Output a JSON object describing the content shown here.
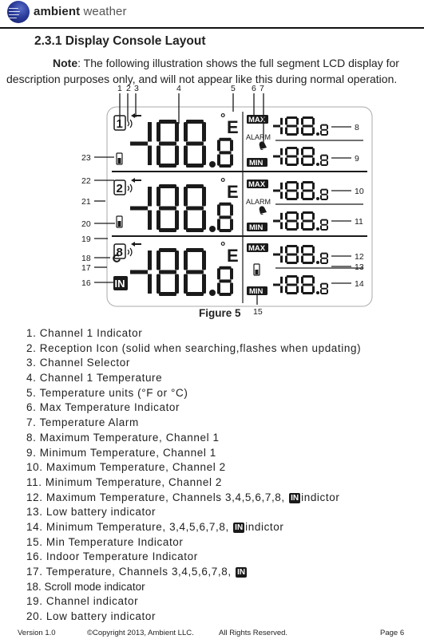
{
  "header": {
    "brand_bold": "ambient",
    "brand_light": " weather"
  },
  "section": {
    "title": "2.3.1 Display Console Layout",
    "note_label": "Note",
    "note_text": ": The following illustration shows the full segment LCD display for description purposes only, and will not appear like this during normal operation."
  },
  "figure": {
    "caption": "Figure 5",
    "lcd": {
      "main_digits": "188.8",
      "side_digits": "188.8",
      "unit": "°F",
      "max_label": "MAX",
      "min_label": "MIN",
      "alarm_label": "ALARM",
      "in_label": "IN",
      "channel_rows": [
        "1",
        "2",
        "8"
      ]
    },
    "callouts": [
      "1",
      "2",
      "3",
      "4",
      "5",
      "6",
      "7",
      "8",
      "9",
      "10",
      "11",
      "12",
      "13",
      "14",
      "15",
      "16",
      "17",
      "18",
      "19",
      "20",
      "21",
      "22",
      "23"
    ]
  },
  "legend": [
    {
      "text": "1. Channel 1 Indicator"
    },
    {
      "text": "2. Reception Icon (solid when searching,flashes when updating)"
    },
    {
      "text": "3. Channel Selector"
    },
    {
      "text": "4. Channel 1 Temperature"
    },
    {
      "text": "5. Temperature units (°F or °C)"
    },
    {
      "text": "6. Max Temperature Indicator"
    },
    {
      "text": "7. Temperature Alarm"
    },
    {
      "text": "8. Maximum Temperature, Channel 1"
    },
    {
      "text": "9. Minimum Temperature, Channel 1"
    },
    {
      "text": "10. Maximum Temperature, Channel 2"
    },
    {
      "text": "11. Minimum Temperature, Channel 2"
    },
    {
      "text": "12. Maximum Temperature, Channels 3,4,5,6,7,8, ",
      "badge": "IN",
      "after": "indictor"
    },
    {
      "text": "13. Low battery indicator"
    },
    {
      "text": "14. Minimum Temperature, 3,4,5,6,7,8, ",
      "badge": "IN",
      "after": "indictor"
    },
    {
      "text": "15. Min Temperature Indicator"
    },
    {
      "text": "16. Indoor Temperature Indicator"
    },
    {
      "text": "17. Temperature, Channels 3,4,5,6,7,8, ",
      "badge": "IN",
      "after": ""
    },
    {
      "text": "18. Scroll mode indicator"
    },
    {
      "text": "19. Channel indicator"
    },
    {
      "text": "20. Low battery indicator"
    }
  ],
  "footer": {
    "version": "Version 1.0",
    "copyright": "©Copyright 2013, Ambient  LLC.",
    "rights": "All Rights Reserved.",
    "page": "Page 6"
  }
}
